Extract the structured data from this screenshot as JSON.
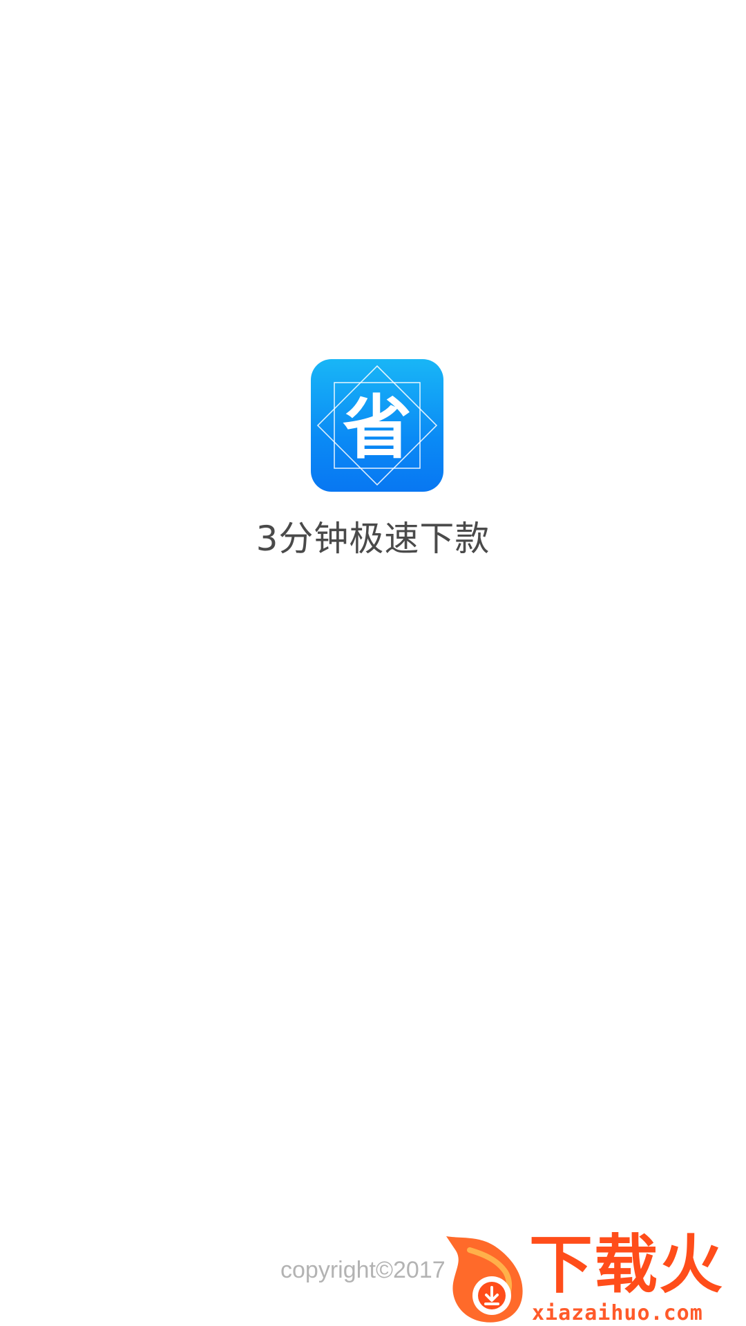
{
  "splash": {
    "app_icon_glyph": "省",
    "app_icon_name": "app-logo-icon",
    "app_name": "3分钟极速下款",
    "copyright": "copyright©2017"
  },
  "watermark": {
    "brand": "下载火",
    "url": "xiazaihuo.com",
    "icon_name": "flame-download-icon"
  },
  "colors": {
    "background": "#ffffff",
    "icon_blue_top": "#19b6f6",
    "icon_blue_bottom": "#0877f2",
    "app_name_text": "#4a4a4a",
    "copyright_text": "#b3b3b3",
    "watermark_orange": "#ff4d1a"
  }
}
